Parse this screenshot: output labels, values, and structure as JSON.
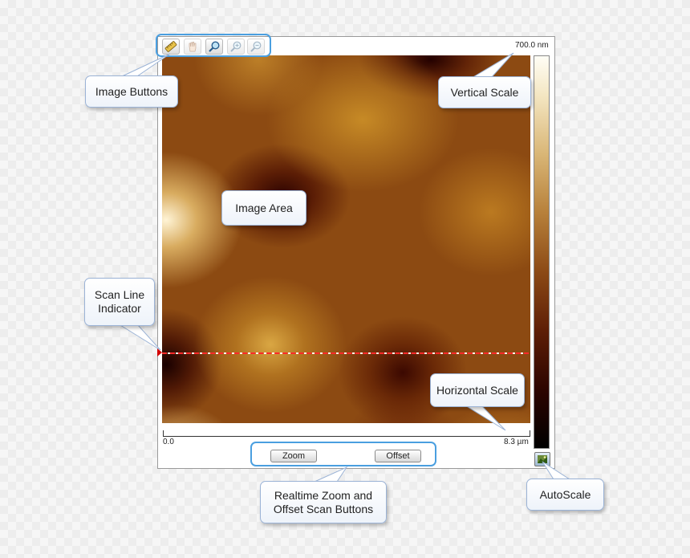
{
  "toolbar": {
    "buttons": [
      {
        "name": "ruler-icon",
        "enabled": true
      },
      {
        "name": "hand-pan-icon",
        "enabled": false
      },
      {
        "name": "magnifier-icon",
        "enabled": true
      },
      {
        "name": "zoom-in-icon",
        "enabled": false
      },
      {
        "name": "zoom-out-icon",
        "enabled": false
      }
    ]
  },
  "scales": {
    "vertical_max": "700.0 nm",
    "horizontal_min": "0.0",
    "horizontal_max": "8.3 µm"
  },
  "scan_buttons": {
    "zoom_label": "Zoom",
    "offset_label": "Offset"
  },
  "callouts": {
    "image_buttons": "Image Buttons",
    "vertical_scale": "Vertical Scale",
    "image_area": "Image Area",
    "scan_line_indicator_1": "Scan Line",
    "scan_line_indicator_2": "Indicator",
    "horizontal_scale": "Horizontal Scale",
    "realtime_1": "Realtime Zoom and",
    "realtime_2": "Offset Scan Buttons",
    "autoscale": "AutoScale"
  },
  "colors": {
    "highlight_outline": "#4a9fe0",
    "scan_line": "#ff2a2a",
    "callout_border": "#9bb3d6"
  }
}
